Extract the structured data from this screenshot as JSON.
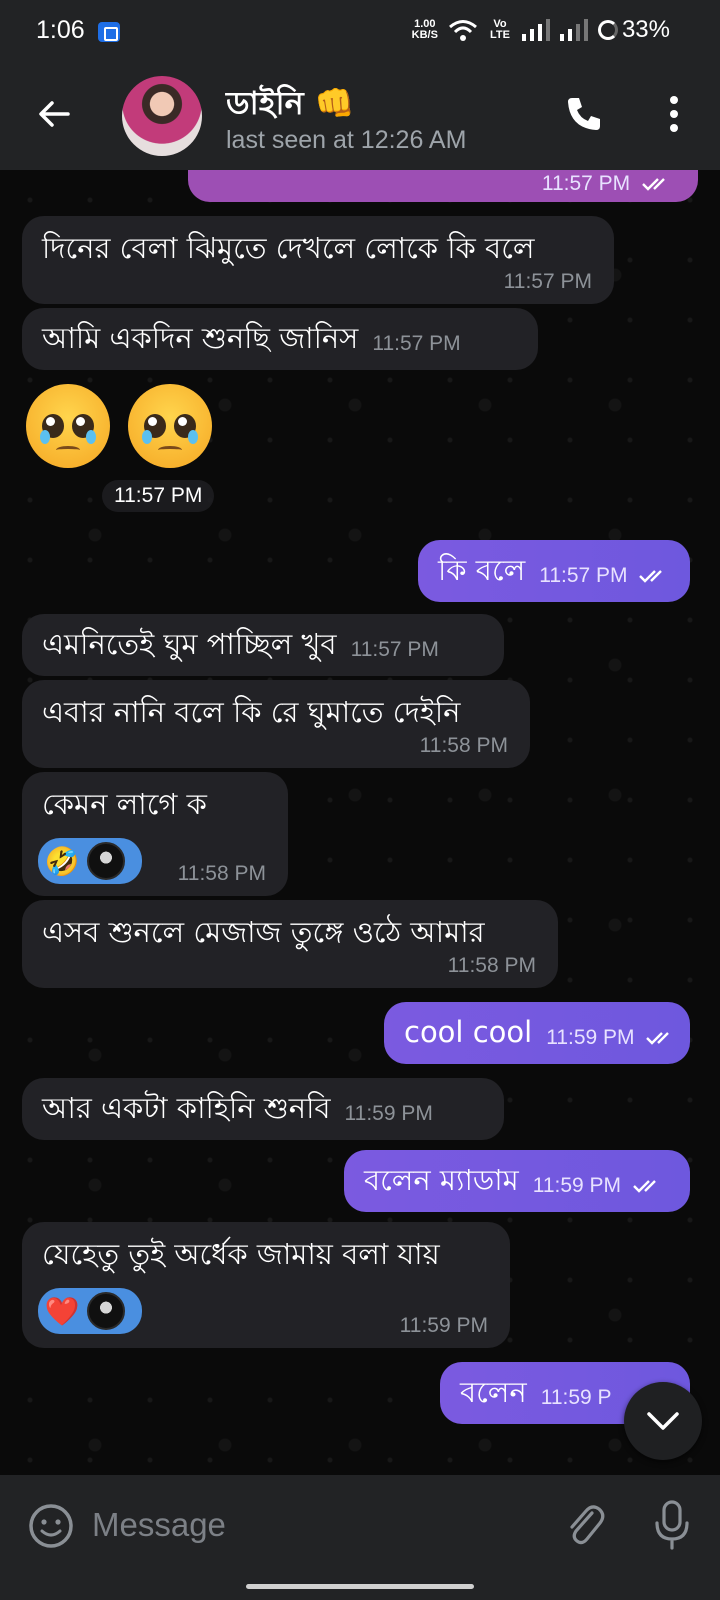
{
  "status_bar": {
    "time": "1:06",
    "speed_value": "1.00",
    "speed_unit": "KB/S",
    "network": "Vo LTE",
    "battery": "33%"
  },
  "header": {
    "contact_name": "ডাইনি 👊",
    "last_seen": "last seen at 12:26 AM"
  },
  "messages": [
    {
      "dir": "out",
      "text": "",
      "time": "11:57 PM"
    },
    {
      "dir": "in",
      "text": "দিনের বেলা ঝিমুতে দেখলে লোকে কি বলে",
      "time": "11:57 PM"
    },
    {
      "dir": "in",
      "text": "আমি একদিন শুনছি জানিস",
      "time": "11:57 PM"
    },
    {
      "dir": "in",
      "sticker": "pleading-face-x2",
      "time": "11:57 PM"
    },
    {
      "dir": "out",
      "text": "কি বলে",
      "time": "11:57 PM"
    },
    {
      "dir": "in",
      "text": "এমনিতেই ঘুম পাচ্ছিল খুব",
      "time": "11:57 PM"
    },
    {
      "dir": "in",
      "text": "এবার নানি বলে কি রে ঘুমাতে দেইনি",
      "time": "11:58 PM"
    },
    {
      "dir": "in",
      "text": "কেমন লাগে ক",
      "time": "11:58 PM",
      "reaction": "🤣"
    },
    {
      "dir": "in",
      "text": "এসব শুনলে মেজাজ তুঙ্গে ওঠে আমার",
      "time": "11:58 PM"
    },
    {
      "dir": "out",
      "text": "cool cool",
      "time": "11:59 PM"
    },
    {
      "dir": "in",
      "text": "আর একটা কাহিনি শুনবি",
      "time": "11:59 PM"
    },
    {
      "dir": "out",
      "text": "বলেন ম্যাডাম",
      "time": "11:59 PM"
    },
    {
      "dir": "in",
      "text": "যেহেতু তুই অর্ধেক জামায় বলা যায়",
      "time": "11:59 PM",
      "reaction": "❤️"
    },
    {
      "dir": "out",
      "text": "বলেন",
      "time": "11:59 P"
    }
  ],
  "input": {
    "placeholder": "Message"
  },
  "colors": {
    "incoming_bubble": "#222226",
    "outgoing_bubble": "#7b5ae0",
    "header_bg": "#222325",
    "reaction_bg": "#4a8fe0"
  }
}
